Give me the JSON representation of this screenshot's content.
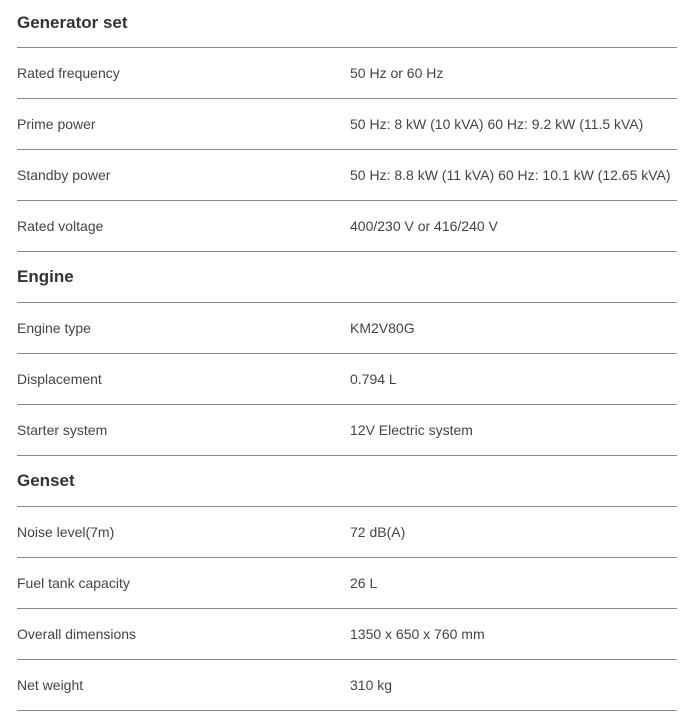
{
  "sections": [
    {
      "title": "Generator set",
      "rows": [
        {
          "label": "Rated frequency",
          "value": "50 Hz or 60 Hz"
        },
        {
          "label": "Prime power",
          "value": "50 Hz: 8 kW (10 kVA) 60 Hz: 9.2 kW (11.5 kVA)"
        },
        {
          "label": "Standby power",
          "value": "50 Hz: 8.8 kW (11 kVA) 60 Hz: 10.1 kW (12.65 kVA)"
        },
        {
          "label": "Rated voltage",
          "value": "400/230 V or 416/240 V"
        }
      ]
    },
    {
      "title": "Engine",
      "rows": [
        {
          "label": "Engine type",
          "value": "KM2V80G"
        },
        {
          "label": "Displacement",
          "value": "0.794 L"
        },
        {
          "label": "Starter system",
          "value": "12V Electric system"
        }
      ]
    },
    {
      "title": "Genset",
      "rows": [
        {
          "label": "Noise level(7m)",
          "value": "72 dB(A)"
        },
        {
          "label": "Fuel tank capacity",
          "value": "26 L"
        },
        {
          "label": "Overall dimensions",
          "value": "1350 x 650 x 760 mm"
        },
        {
          "label": "Net weight",
          "value": "310 kg"
        }
      ]
    }
  ]
}
